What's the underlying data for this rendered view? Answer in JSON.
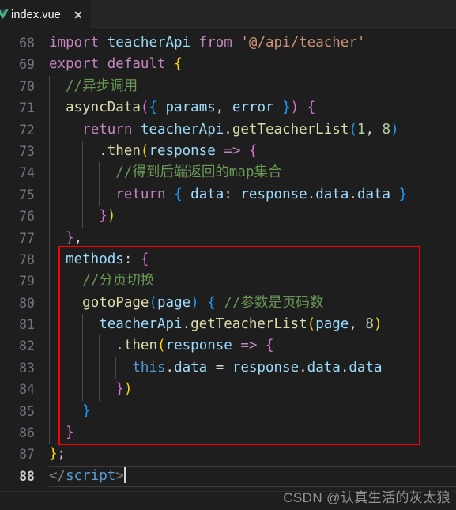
{
  "window": {
    "background": "#1e1e1e",
    "tabbar_background": "#252526"
  },
  "tabbar": {
    "tabs": [
      {
        "label": "index.vue",
        "icon": "vue-file-icon",
        "close_label": "✕",
        "active": true
      }
    ]
  },
  "editor": {
    "language": "vue",
    "first_visible_line": 68,
    "last_visible_line": 88,
    "current_line": 88,
    "cursor": {
      "line": 88,
      "column": 10
    },
    "lines": [
      {
        "number": "68",
        "indent_guides": 0,
        "tokens": [
          {
            "text": "import",
            "cls": "t-key"
          },
          {
            "text": " ",
            "cls": "t-pun"
          },
          {
            "text": "teacherApi",
            "cls": "t-var"
          },
          {
            "text": " ",
            "cls": "t-pun"
          },
          {
            "text": "from",
            "cls": "t-key"
          },
          {
            "text": " ",
            "cls": "t-pun"
          },
          {
            "text": "'@/api/teacher'",
            "cls": "t-str"
          }
        ]
      },
      {
        "number": "69",
        "indent_guides": 0,
        "tokens": [
          {
            "text": "export",
            "cls": "t-key"
          },
          {
            "text": " ",
            "cls": "t-pun"
          },
          {
            "text": "default",
            "cls": "t-key"
          },
          {
            "text": " ",
            "cls": "t-pun"
          },
          {
            "text": "{",
            "cls": "t-b1"
          }
        ]
      },
      {
        "number": "70",
        "indent_guides": 1,
        "tokens": [
          {
            "text": "  ",
            "cls": "t-pun"
          },
          {
            "text": "//异步调用",
            "cls": "t-com"
          }
        ]
      },
      {
        "number": "71",
        "indent_guides": 1,
        "tokens": [
          {
            "text": "  ",
            "cls": "t-pun"
          },
          {
            "text": "asyncData",
            "cls": "t-fn"
          },
          {
            "text": "(",
            "cls": "t-b2"
          },
          {
            "text": "{",
            "cls": "t-b3"
          },
          {
            "text": " ",
            "cls": "t-pun"
          },
          {
            "text": "params",
            "cls": "t-var"
          },
          {
            "text": ", ",
            "cls": "t-pun"
          },
          {
            "text": "error",
            "cls": "t-var"
          },
          {
            "text": " ",
            "cls": "t-pun"
          },
          {
            "text": "}",
            "cls": "t-b3"
          },
          {
            "text": ")",
            "cls": "t-b2"
          },
          {
            "text": " ",
            "cls": "t-pun"
          },
          {
            "text": "{",
            "cls": "t-b2"
          }
        ]
      },
      {
        "number": "72",
        "indent_guides": 2,
        "tokens": [
          {
            "text": "    ",
            "cls": "t-pun"
          },
          {
            "text": "return",
            "cls": "t-key"
          },
          {
            "text": " ",
            "cls": "t-pun"
          },
          {
            "text": "teacherApi",
            "cls": "t-var"
          },
          {
            "text": ".",
            "cls": "t-pun"
          },
          {
            "text": "getTeacherList",
            "cls": "t-fn"
          },
          {
            "text": "(",
            "cls": "t-b3"
          },
          {
            "text": "1",
            "cls": "t-num"
          },
          {
            "text": ", ",
            "cls": "t-pun"
          },
          {
            "text": "8",
            "cls": "t-num"
          },
          {
            "text": ")",
            "cls": "t-b3"
          }
        ]
      },
      {
        "number": "73",
        "indent_guides": 3,
        "tokens": [
          {
            "text": "      ",
            "cls": "t-pun"
          },
          {
            "text": ".",
            "cls": "t-pun"
          },
          {
            "text": "then",
            "cls": "t-fn"
          },
          {
            "text": "(",
            "cls": "t-b1"
          },
          {
            "text": "response",
            "cls": "t-var"
          },
          {
            "text": " ",
            "cls": "t-pun"
          },
          {
            "text": "=>",
            "cls": "t-key"
          },
          {
            "text": " ",
            "cls": "t-pun"
          },
          {
            "text": "{",
            "cls": "t-b2"
          }
        ]
      },
      {
        "number": "74",
        "indent_guides": 4,
        "tokens": [
          {
            "text": "        ",
            "cls": "t-pun"
          },
          {
            "text": "//得到后端返回的map集合",
            "cls": "t-com"
          }
        ]
      },
      {
        "number": "75",
        "indent_guides": 4,
        "tokens": [
          {
            "text": "        ",
            "cls": "t-pun"
          },
          {
            "text": "return",
            "cls": "t-key"
          },
          {
            "text": " ",
            "cls": "t-pun"
          },
          {
            "text": "{",
            "cls": "t-b3"
          },
          {
            "text": " ",
            "cls": "t-pun"
          },
          {
            "text": "data",
            "cls": "t-var"
          },
          {
            "text": ": ",
            "cls": "t-pun"
          },
          {
            "text": "response",
            "cls": "t-var"
          },
          {
            "text": ".",
            "cls": "t-pun"
          },
          {
            "text": "data",
            "cls": "t-prop"
          },
          {
            "text": ".",
            "cls": "t-pun"
          },
          {
            "text": "data",
            "cls": "t-prop"
          },
          {
            "text": " ",
            "cls": "t-pun"
          },
          {
            "text": "}",
            "cls": "t-b3"
          }
        ]
      },
      {
        "number": "76",
        "indent_guides": 3,
        "tokens": [
          {
            "text": "      ",
            "cls": "t-pun"
          },
          {
            "text": "}",
            "cls": "t-b2"
          },
          {
            "text": ")",
            "cls": "t-b1"
          }
        ]
      },
      {
        "number": "77",
        "indent_guides": 1,
        "tokens": [
          {
            "text": "  ",
            "cls": "t-pun"
          },
          {
            "text": "}",
            "cls": "t-b2"
          },
          {
            "text": ",",
            "cls": "t-pun"
          }
        ]
      },
      {
        "number": "78",
        "indent_guides": 1,
        "tokens": [
          {
            "text": "  ",
            "cls": "t-pun"
          },
          {
            "text": "methods",
            "cls": "t-var"
          },
          {
            "text": ": ",
            "cls": "t-pun"
          },
          {
            "text": "{",
            "cls": "t-b2"
          }
        ]
      },
      {
        "number": "79",
        "indent_guides": 2,
        "tokens": [
          {
            "text": "    ",
            "cls": "t-pun"
          },
          {
            "text": "//分页切换",
            "cls": "t-com"
          }
        ]
      },
      {
        "number": "80",
        "indent_guides": 2,
        "tokens": [
          {
            "text": "    ",
            "cls": "t-pun"
          },
          {
            "text": "gotoPage",
            "cls": "t-fn"
          },
          {
            "text": "(",
            "cls": "t-b3"
          },
          {
            "text": "page",
            "cls": "t-var"
          },
          {
            "text": ")",
            "cls": "t-b3"
          },
          {
            "text": " ",
            "cls": "t-pun"
          },
          {
            "text": "{",
            "cls": "t-b3"
          },
          {
            "text": " ",
            "cls": "t-pun"
          },
          {
            "text": "//参数是页码数",
            "cls": "t-com"
          }
        ]
      },
      {
        "number": "81",
        "indent_guides": 3,
        "tokens": [
          {
            "text": "      ",
            "cls": "t-pun"
          },
          {
            "text": "teacherApi",
            "cls": "t-var"
          },
          {
            "text": ".",
            "cls": "t-pun"
          },
          {
            "text": "getTeacherList",
            "cls": "t-fn"
          },
          {
            "text": "(",
            "cls": "t-b1"
          },
          {
            "text": "page",
            "cls": "t-var"
          },
          {
            "text": ", ",
            "cls": "t-pun"
          },
          {
            "text": "8",
            "cls": "t-num"
          },
          {
            "text": ")",
            "cls": "t-b1"
          }
        ]
      },
      {
        "number": "82",
        "indent_guides": 4,
        "tokens": [
          {
            "text": "        ",
            "cls": "t-pun"
          },
          {
            "text": ".",
            "cls": "t-pun"
          },
          {
            "text": "then",
            "cls": "t-fn"
          },
          {
            "text": "(",
            "cls": "t-b1"
          },
          {
            "text": "response",
            "cls": "t-var"
          },
          {
            "text": " ",
            "cls": "t-pun"
          },
          {
            "text": "=>",
            "cls": "t-key"
          },
          {
            "text": " ",
            "cls": "t-pun"
          },
          {
            "text": "{",
            "cls": "t-b2"
          }
        ]
      },
      {
        "number": "83",
        "indent_guides": 5,
        "tokens": [
          {
            "text": "          ",
            "cls": "t-pun"
          },
          {
            "text": "this",
            "cls": "t-this"
          },
          {
            "text": ".",
            "cls": "t-pun"
          },
          {
            "text": "data",
            "cls": "t-prop"
          },
          {
            "text": " = ",
            "cls": "t-pun"
          },
          {
            "text": "response",
            "cls": "t-var"
          },
          {
            "text": ".",
            "cls": "t-pun"
          },
          {
            "text": "data",
            "cls": "t-prop"
          },
          {
            "text": ".",
            "cls": "t-pun"
          },
          {
            "text": "data",
            "cls": "t-prop"
          }
        ]
      },
      {
        "number": "84",
        "indent_guides": 4,
        "tokens": [
          {
            "text": "        ",
            "cls": "t-pun"
          },
          {
            "text": "}",
            "cls": "t-b2"
          },
          {
            "text": ")",
            "cls": "t-b1"
          }
        ]
      },
      {
        "number": "85",
        "indent_guides": 2,
        "tokens": [
          {
            "text": "    ",
            "cls": "t-pun"
          },
          {
            "text": "}",
            "cls": "t-b3"
          }
        ]
      },
      {
        "number": "86",
        "indent_guides": 1,
        "tokens": [
          {
            "text": "  ",
            "cls": "t-pun"
          },
          {
            "text": "}",
            "cls": "t-b2"
          }
        ]
      },
      {
        "number": "87",
        "indent_guides": 0,
        "tokens": [
          {
            "text": "}",
            "cls": "t-b1"
          },
          {
            "text": ";",
            "cls": "t-pun"
          }
        ]
      },
      {
        "number": "88",
        "indent_guides": 0,
        "current": true,
        "tokens": [
          {
            "text": "</",
            "cls": "t-tagpun"
          },
          {
            "text": "script",
            "cls": "t-tag"
          },
          {
            "text": ">",
            "cls": "t-tagpun"
          }
        ]
      }
    ]
  },
  "annotation": {
    "shape": "rectangle",
    "color": "#ff0000",
    "covers_lines": "78-86"
  },
  "watermark": {
    "text": "CSDN @认真生活的灰太狼"
  }
}
